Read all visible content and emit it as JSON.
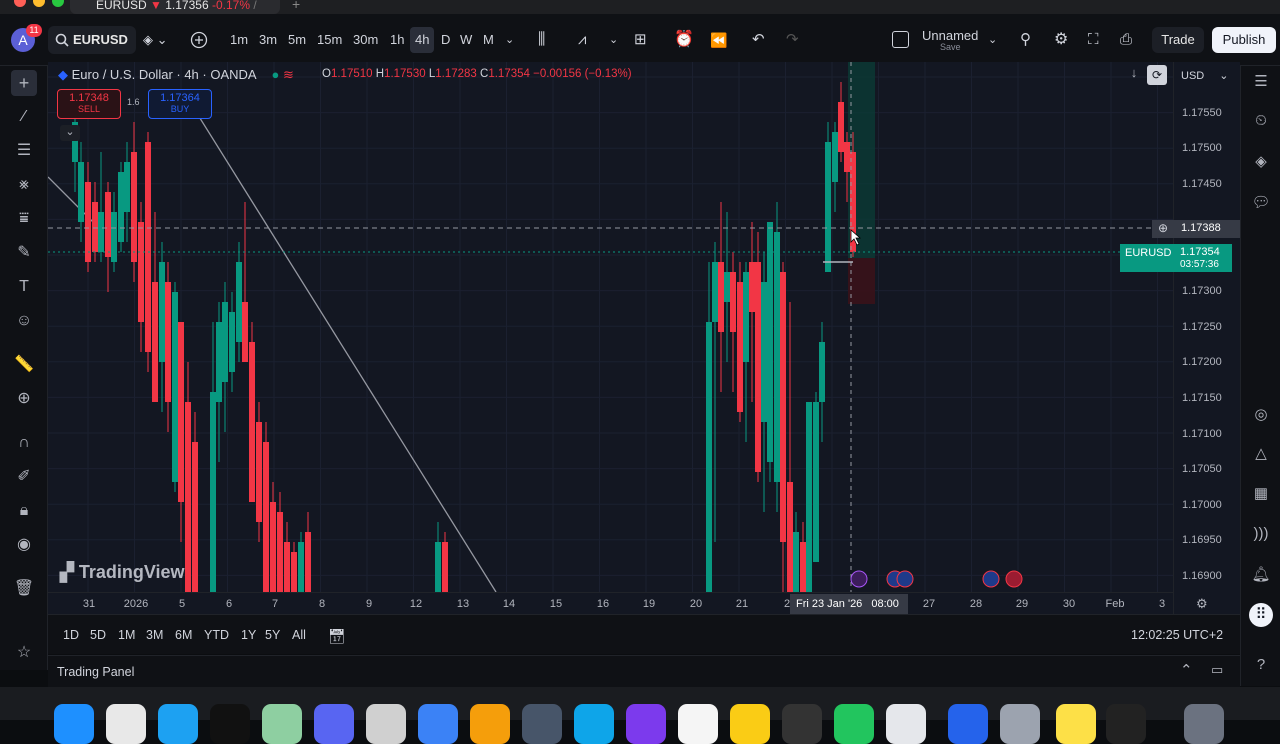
{
  "window": {
    "tab_symbol": "EURUSD",
    "tab_arrow": "▼",
    "tab_price": "1.17356",
    "tab_change": "-0.17%",
    "tab_sep": "/"
  },
  "toolbar": {
    "avatar_letter": "A",
    "notif_count": "11",
    "symbol": "EURUSD",
    "intervals": [
      "1m",
      "3m",
      "5m",
      "15m",
      "30m",
      "1h",
      "4h",
      "D",
      "W",
      "M"
    ],
    "active_interval": "4h",
    "layout_name": "Unnamed",
    "layout_sub": "Save",
    "trade_label": "Trade",
    "publish_label": "Publish"
  },
  "legend": {
    "title": "Euro / U.S. Dollar · 4h · OANDA",
    "o_label": "O",
    "o": "1.17510",
    "h_label": "H",
    "h": "1.17530",
    "l_label": "L",
    "l": "1.17283",
    "c_label": "C",
    "c": "1.17354",
    "change": "−0.00156 (−0.13%)",
    "sell_price": "1.17348",
    "sell_label": "SELL",
    "spread": "1.6",
    "buy_price": "1.17364",
    "buy_label": "BUY"
  },
  "price_axis": {
    "currency": "USD",
    "labels": [
      "1.17550",
      "1.17500",
      "1.17450",
      "1.17300",
      "1.17250",
      "1.17200",
      "1.17150",
      "1.17100",
      "1.17050",
      "1.17000",
      "1.16950",
      "1.16900"
    ],
    "crosshair_price": "1.17388",
    "current_symbol": "EURUSD",
    "current_price": "1.17354",
    "countdown": "03:57:36"
  },
  "time_axis": {
    "labels": [
      "31",
      "2026",
      "5",
      "6",
      "7",
      "8",
      "9",
      "12",
      "13",
      "14",
      "15",
      "16",
      "19",
      "20",
      "21",
      "2",
      "27",
      "28",
      "29",
      "30",
      "Feb",
      "3"
    ],
    "crosshair_date": "Fri 23 Jan '26",
    "crosshair_time": "08:00"
  },
  "range_bar": {
    "ranges": [
      "1D",
      "5D",
      "1M",
      "3M",
      "6M",
      "YTD",
      "1Y",
      "5Y",
      "All"
    ],
    "clock": "12:02:25 UTC+2"
  },
  "watermark": "TradingView",
  "trading_panel": {
    "label": "Trading Panel"
  },
  "colors": {
    "up": "#089981",
    "down": "#f23645",
    "bg": "#131722"
  }
}
